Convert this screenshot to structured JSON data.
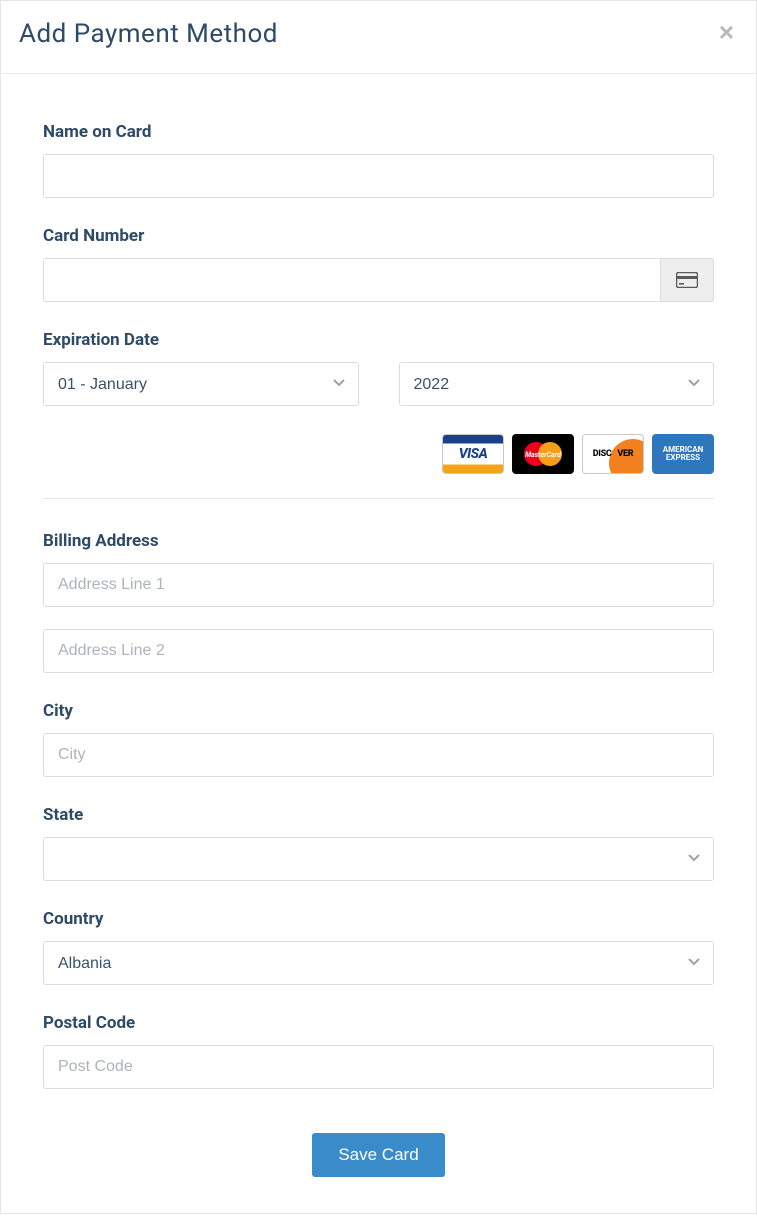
{
  "header": {
    "title": "Add Payment Method"
  },
  "form": {
    "name_on_card": {
      "label": "Name on Card",
      "value": ""
    },
    "card_number": {
      "label": "Card Number",
      "value": ""
    },
    "expiration": {
      "label": "Expiration Date",
      "month_selected": "01 - January",
      "year_selected": "2022"
    },
    "card_logos": [
      "visa",
      "mastercard",
      "discover",
      "amex"
    ],
    "billing_address": {
      "label": "Billing Address",
      "line1_placeholder": "Address Line 1",
      "line1_value": "",
      "line2_placeholder": "Address Line 2",
      "line2_value": ""
    },
    "city": {
      "label": "City",
      "placeholder": "City",
      "value": ""
    },
    "state": {
      "label": "State",
      "selected": ""
    },
    "country": {
      "label": "Country",
      "selected": "Albania"
    },
    "postal_code": {
      "label": "Postal Code",
      "placeholder": "Post Code",
      "value": ""
    }
  },
  "footer": {
    "save_label": "Save Card"
  }
}
